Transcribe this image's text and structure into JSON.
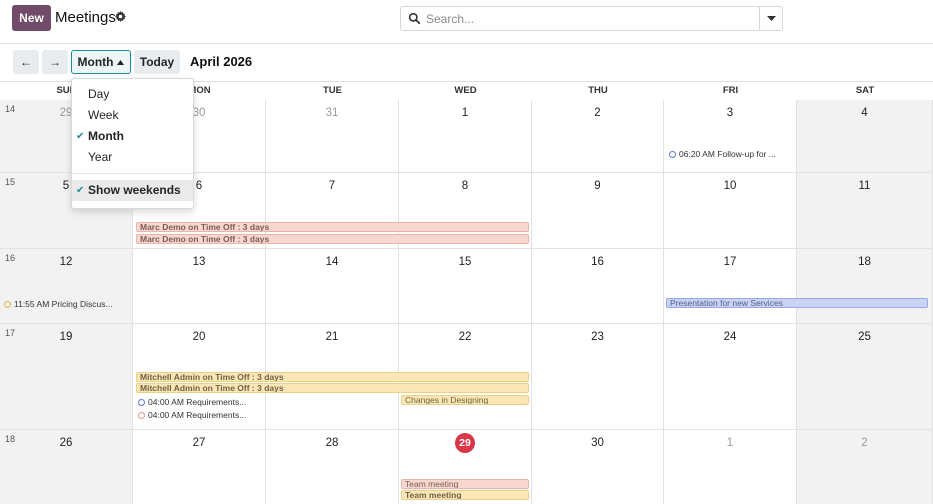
{
  "header": {
    "new_label": "New",
    "title": "Meetings",
    "search_placeholder": "Search..."
  },
  "toolbar": {
    "prev_label": "←",
    "next_label": "→",
    "scale_label": "Month",
    "today_label": "Today",
    "period_label": "April 2026"
  },
  "scale_menu": {
    "items": [
      {
        "label": "Day",
        "checked": false
      },
      {
        "label": "Week",
        "checked": false
      },
      {
        "label": "Month",
        "checked": true
      },
      {
        "label": "Year",
        "checked": false
      }
    ],
    "weekends_label": "Show weekends",
    "weekends_checked": true
  },
  "calendar": {
    "days_of_week": [
      "SUN",
      "MON",
      "TUE",
      "WED",
      "THU",
      "FRI",
      "SAT"
    ],
    "weeks": [
      {
        "num": "14",
        "days": [
          "29",
          "30",
          "31",
          "1",
          "2",
          "3",
          "4"
        ],
        "muted": [
          true,
          true,
          true,
          false,
          false,
          false,
          false
        ]
      },
      {
        "num": "15",
        "days": [
          "5",
          "6",
          "7",
          "8",
          "9",
          "10",
          "11"
        ],
        "muted": [
          false,
          false,
          false,
          false,
          false,
          false,
          false
        ]
      },
      {
        "num": "16",
        "days": [
          "12",
          "13",
          "14",
          "15",
          "16",
          "17",
          "18"
        ],
        "muted": [
          false,
          false,
          false,
          false,
          false,
          false,
          false
        ]
      },
      {
        "num": "17",
        "days": [
          "19",
          "20",
          "21",
          "22",
          "23",
          "24",
          "25"
        ],
        "muted": [
          false,
          false,
          false,
          false,
          false,
          false,
          false
        ]
      },
      {
        "num": "18",
        "days": [
          "26",
          "27",
          "28",
          "29",
          "30",
          "1",
          "2"
        ],
        "muted": [
          false,
          false,
          false,
          false,
          false,
          true,
          true
        ]
      }
    ],
    "today": "29",
    "events": {
      "followup": "06:20 AM Follow-up for ...",
      "marc_timeoff_1": "Marc Demo on Time Off : 3 days",
      "marc_timeoff_2": "Marc Demo on Time Off : 3 days",
      "pricing": "11:55 AM Pricing Discus...",
      "presentation": "Presentation for new Services",
      "mitchell_timeoff_1": "Mitchell Admin on Time Off : 3 days",
      "mitchell_timeoff_2": "Mitchell Admin on Time Off : 3 days",
      "requirements_1": "04:00 AM Requirements...",
      "requirements_2": "04:00 AM Requirements...",
      "changes": "Changes in Designing",
      "team_meeting_1": "Team meeting",
      "team_meeting_2": "Team meeting"
    }
  },
  "colors": {
    "brand": "#714b67",
    "accent": "#1d8b94",
    "today": "#d9364a"
  }
}
